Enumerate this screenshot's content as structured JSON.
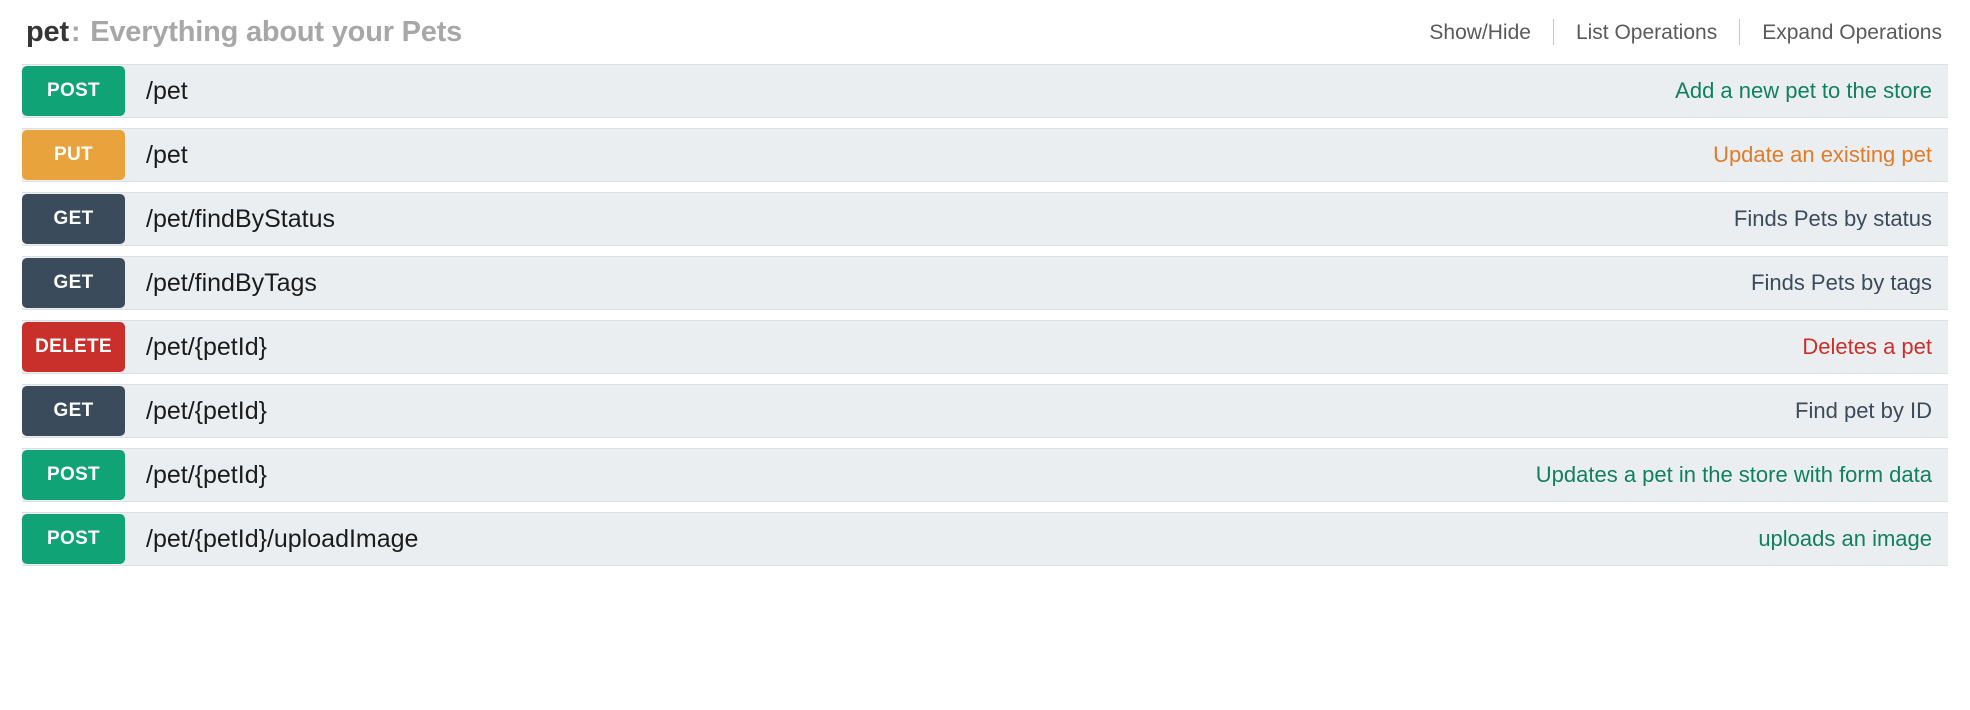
{
  "resource": {
    "tag": "pet",
    "separator": ":",
    "description": "Everything about your Pets"
  },
  "options": [
    {
      "label": "Show/Hide",
      "name": "show-hide-link"
    },
    {
      "label": "List Operations",
      "name": "list-operations-link"
    },
    {
      "label": "Expand Operations",
      "name": "expand-operations-link"
    }
  ],
  "colors": {
    "post": "#10a375",
    "put": "#e9a33c",
    "get": "#3a4b5c",
    "delete": "#c9302c",
    "row_background": "#ebeef0",
    "row_border": "#dde1e3",
    "title_tag": "#353535",
    "title_description": "#a7a7a7",
    "option_link": "#5a5a5a"
  },
  "operations": [
    {
      "method": "POST",
      "method_key": "post",
      "path": "/pet",
      "summary": "Add a new pet to the store"
    },
    {
      "method": "PUT",
      "method_key": "put",
      "path": "/pet",
      "summary": "Update an existing pet"
    },
    {
      "method": "GET",
      "method_key": "get",
      "path": "/pet/findByStatus",
      "summary": "Finds Pets by status"
    },
    {
      "method": "GET",
      "method_key": "get",
      "path": "/pet/findByTags",
      "summary": "Finds Pets by tags"
    },
    {
      "method": "DELETE",
      "method_key": "delete",
      "path": "/pet/{petId}",
      "summary": "Deletes a pet"
    },
    {
      "method": "GET",
      "method_key": "get",
      "path": "/pet/{petId}",
      "summary": "Find pet by ID"
    },
    {
      "method": "POST",
      "method_key": "post",
      "path": "/pet/{petId}",
      "summary": "Updates a pet in the store with form data"
    },
    {
      "method": "POST",
      "method_key": "post",
      "path": "/pet/{petId}/uploadImage",
      "summary": "uploads an image"
    }
  ]
}
